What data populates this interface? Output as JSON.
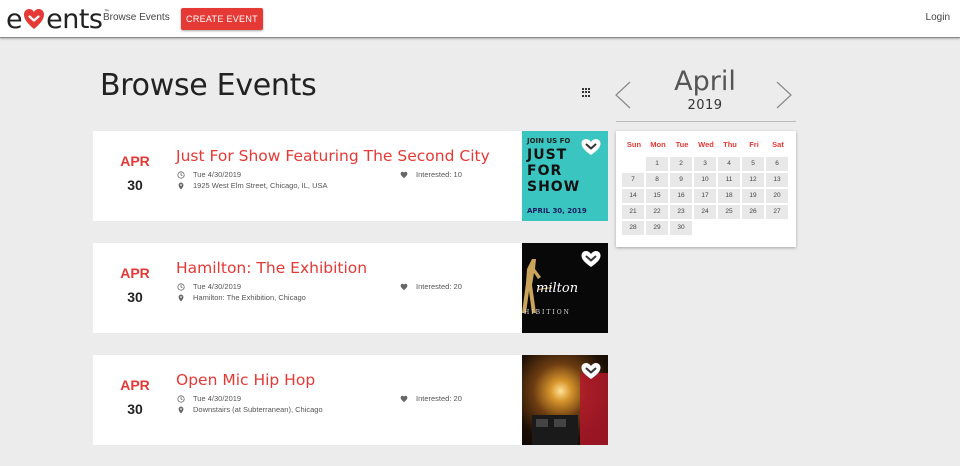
{
  "nav": {
    "logo_text_pre": "e",
    "logo_text_post": "ents",
    "logo_tm": "™",
    "browse_link": "Browse Events",
    "create_button": "CREATE EVENT",
    "login_link": "Login"
  },
  "page": {
    "title": "Browse Events"
  },
  "events": [
    {
      "month": "APR",
      "day": "30",
      "title": "Just For Show Featuring The Second City",
      "date_text": "Tue 4/30/2019",
      "location": "1925 West Elm Street, Chicago, IL, USA",
      "interested": "Interested: 10",
      "thumb_lines": [
        "JOIN US FO",
        "JUST",
        "FOR",
        "SHOW",
        "APRIL 30, 2019"
      ]
    },
    {
      "month": "APR",
      "day": "30",
      "title": "Hamilton: The Exhibition",
      "date_text": "Tue 4/30/2019",
      "location": "Hamilton: The Exhibition, Chicago",
      "interested": "Interested: 20",
      "thumb_lines": [
        "milton",
        "HIBITION"
      ]
    },
    {
      "month": "APR",
      "day": "30",
      "title": "Open Mic Hip Hop",
      "date_text": "Tue 4/30/2019",
      "location": "Downstairs (at Subterranean), Chicago",
      "interested": "Interested: 20",
      "thumb_lines": []
    }
  ],
  "calendar": {
    "month": "April",
    "year": "2019",
    "weekdays": [
      "Sun",
      "Mon",
      "Tue",
      "Wed",
      "Thu",
      "Fri",
      "Sat"
    ],
    "days": [
      "",
      "1",
      "2",
      "3",
      "4",
      "5",
      "6",
      "7",
      "8",
      "9",
      "10",
      "11",
      "12",
      "13",
      "14",
      "15",
      "16",
      "17",
      "18",
      "19",
      "20",
      "21",
      "22",
      "23",
      "24",
      "25",
      "26",
      "27",
      "28",
      "29",
      "30"
    ]
  },
  "colors": {
    "accent": "#e53935",
    "background": "#ececec"
  },
  "icons": {
    "clock": "clock-icon",
    "location": "map-pin-icon",
    "interest": "heart-icon",
    "favorite": "favorite-heart-icon",
    "view_toggle": "grid-icon",
    "prev": "chevron-left-icon",
    "next": "chevron-right-icon"
  }
}
